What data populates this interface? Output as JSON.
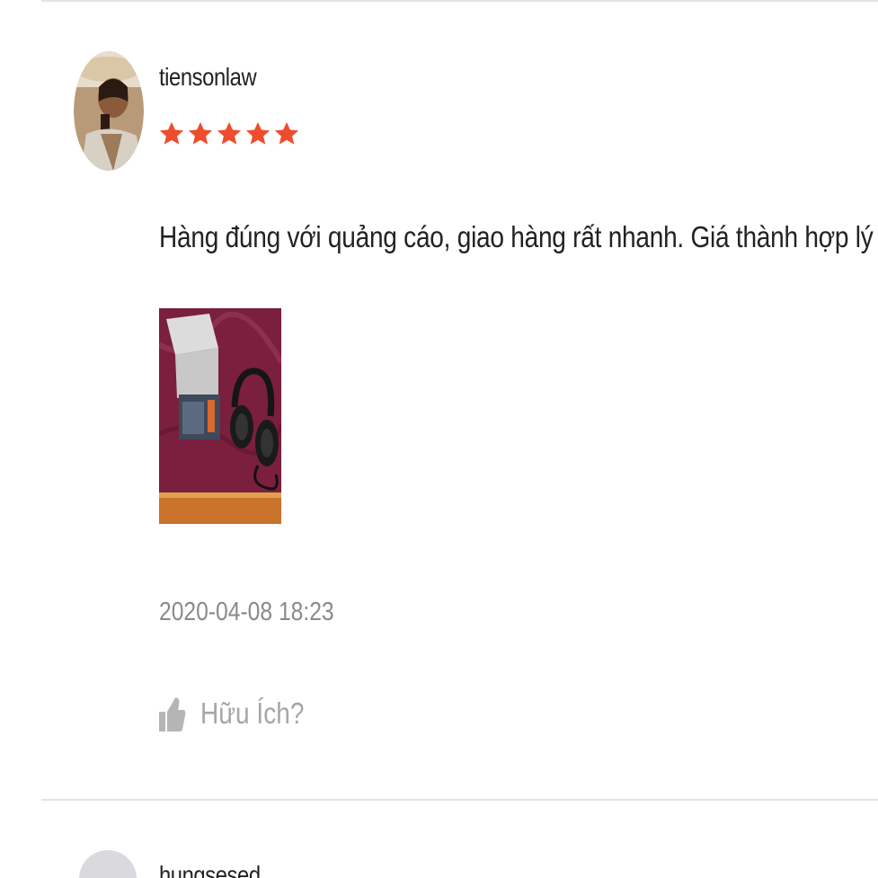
{
  "reviews": [
    {
      "username": "tiensonlaw",
      "rating": 5,
      "rating_max": 5,
      "comment": "Hàng đúng với quảng cáo, giao hàng rất nhanh. Giá thành hợp lý",
      "timestamp": "2020-04-08 18:23",
      "helpful_label": "Hữu Ích?"
    },
    {
      "username": "hungsesed"
    }
  ],
  "colors": {
    "star": "#ee4d2d",
    "divider": "#e4e4e4",
    "text": "#222222",
    "muted": "#8a8a8a",
    "helpful": "#a6a6a6"
  },
  "icons": {
    "star": "star-icon",
    "helpful": "thumbs-up-icon"
  }
}
